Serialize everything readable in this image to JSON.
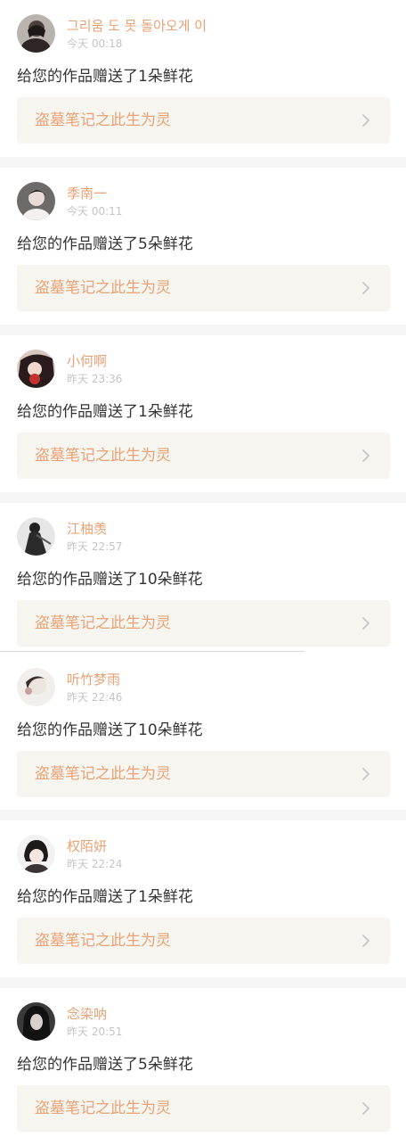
{
  "notifications": [
    {
      "username": "그리움 도 못 돌아오게 이",
      "time": "今天 00:18",
      "message": "给您的作品赠送了1朵鲜花",
      "work_title": "盗墓笔记之此生为灵",
      "avatar_icon": "user-avatar"
    },
    {
      "username": "季南一",
      "time": "今天 00:11",
      "message": "给您的作品赠送了5朵鲜花",
      "work_title": "盗墓笔记之此生为灵",
      "avatar_icon": "user-avatar"
    },
    {
      "username": "小何啊",
      "time": "昨天 23:36",
      "message": "给您的作品赠送了1朵鲜花",
      "work_title": "盗墓笔记之此生为灵",
      "avatar_icon": "user-avatar"
    },
    {
      "username": "江柚羡",
      "time": "昨天 22:57",
      "message": "给您的作品赠送了10朵鲜花",
      "work_title": "盗墓笔记之此生为灵",
      "avatar_icon": "user-avatar"
    },
    {
      "username": "听竹梦雨",
      "time": "昨天 22:46",
      "message": "给您的作品赠送了10朵鲜花",
      "work_title": "盗墓笔记之此生为灵",
      "avatar_icon": "user-avatar"
    },
    {
      "username": "权陌妍",
      "time": "昨天 22:24",
      "message": "给您的作品赠送了1朵鲜花",
      "work_title": "盗墓笔记之此生为灵",
      "avatar_icon": "user-avatar"
    },
    {
      "username": "念染呐",
      "time": "昨天 20:51",
      "message": "给您的作品赠送了5朵鲜花",
      "work_title": "盗墓笔记之此生为灵",
      "avatar_icon": "user-avatar"
    }
  ],
  "colors": {
    "accent": "#e8a275",
    "text": "#333333",
    "muted": "#c4c4c4",
    "link_background": "#f6f5ef",
    "separator": "#f5f5f5",
    "chevron": "#c7c7c7"
  },
  "icons": {
    "chevron": "chevron-right-icon"
  }
}
